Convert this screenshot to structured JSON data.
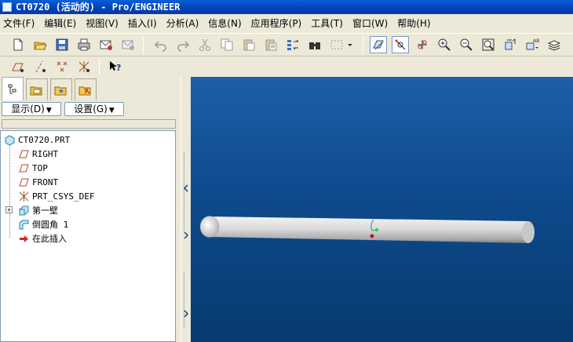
{
  "window": {
    "title": "CT0720 (活动的) - Pro/ENGINEER"
  },
  "menubar": {
    "items": [
      "文件(F)",
      "编辑(E)",
      "视图(V)",
      "插入(I)",
      "分析(A)",
      "信息(N)",
      "应用程序(P)",
      "工具(T)",
      "窗口(W)",
      "帮助(H)"
    ]
  },
  "toolbar": {
    "icons": [
      "new-icon",
      "open-icon",
      "save-icon",
      "print-icon",
      "email-icon",
      "email-link-icon",
      "undo-icon",
      "redo-icon",
      "cut-icon",
      "copy-icon",
      "paste-icon",
      "paste-special-icon",
      "regenerate-icon",
      "find-icon",
      "select-box-icon",
      "datum-plane-display-icon",
      "datum-axis-display-icon",
      "datum-point-display-icon",
      "zoom-in-icon",
      "zoom-out-icon",
      "refit-icon",
      "reorient-icon",
      "saved-views-icon",
      "layers-icon"
    ]
  },
  "toolbar2": {
    "icons": [
      "plane-tag-display-icon",
      "axis-tag-display-icon",
      "point-tag-display-icon",
      "csys-tag-display-icon",
      "context-help-icon"
    ]
  },
  "leftpanel": {
    "tabs": [
      "model-tree-tab",
      "folder-browser-tab",
      "favorites-tab",
      "connections-tab"
    ],
    "show_button": "显示(D)",
    "settings_button": "设置(G)",
    "tree": [
      {
        "label": "CT0720.PRT",
        "icon": "part-icon",
        "indent": 0
      },
      {
        "label": "RIGHT",
        "icon": "datum-plane-icon",
        "indent": 1
      },
      {
        "label": "TOP",
        "icon": "datum-plane-icon",
        "indent": 1
      },
      {
        "label": "FRONT",
        "icon": "datum-plane-icon",
        "indent": 1
      },
      {
        "label": "PRT_CSYS_DEF",
        "icon": "csys-icon",
        "indent": 1
      },
      {
        "label": "第一壁",
        "icon": "first-wall-icon",
        "indent": 1,
        "expandable": true
      },
      {
        "label": "倒圆角 1",
        "icon": "round-icon",
        "indent": 1
      },
      {
        "label": "在此插入",
        "icon": "insert-here-icon",
        "indent": 1
      }
    ]
  },
  "colors": {
    "titlebar": "#0a5fd8",
    "chrome": "#ece9d8",
    "viewport_top": "#1c5fa8",
    "viewport_bottom": "#083a70",
    "part": "#e4e4e4"
  }
}
